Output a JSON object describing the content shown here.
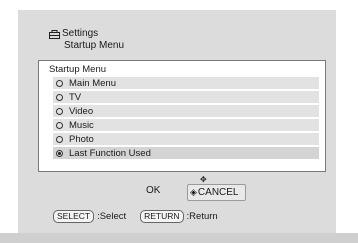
{
  "header": {
    "section": "Settings",
    "subsection": "Startup Menu",
    "icon": "settings-icon"
  },
  "panel": {
    "title": "Startup Menu",
    "options": [
      {
        "label": "Main Menu",
        "selected": false
      },
      {
        "label": "TV",
        "selected": false
      },
      {
        "label": "Video",
        "selected": false
      },
      {
        "label": "Music",
        "selected": false
      },
      {
        "label": "Photo",
        "selected": false
      },
      {
        "label": "Last Function Used",
        "selected": true
      }
    ]
  },
  "buttons": {
    "ok": "OK",
    "cancel": "CANCEL"
  },
  "hints": {
    "select_key": "SELECT",
    "select_text": ":Select",
    "return_key": "RETURN",
    "return_text": ":Return"
  }
}
